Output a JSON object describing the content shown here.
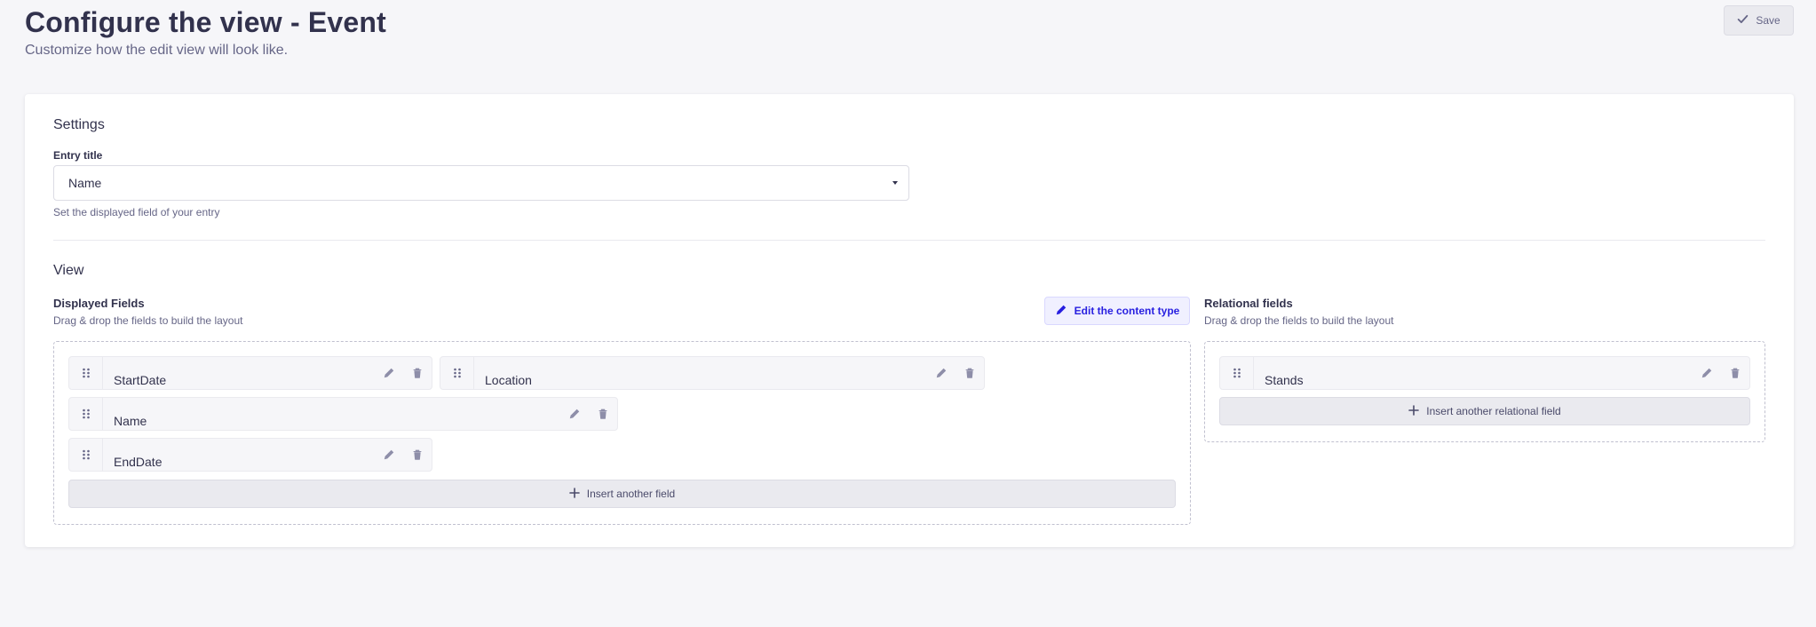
{
  "header": {
    "title": "Configure the view - Event",
    "subtitle": "Customize how the edit view will look like.",
    "save_label": "Save"
  },
  "settings": {
    "title": "Settings",
    "entry_title_label": "Entry title",
    "entry_title_value": "Name",
    "entry_title_hint": "Set the displayed field of your entry"
  },
  "view": {
    "title": "View",
    "displayed": {
      "title": "Displayed Fields",
      "hint": "Drag & drop the fields to build the layout",
      "edit_content_type_label": "Edit the content type",
      "fields": [
        "StartDate",
        "Location",
        "Name",
        "EndDate"
      ],
      "insert_label": "Insert another field"
    },
    "relational": {
      "title": "Relational fields",
      "hint": "Drag & drop the fields to build the layout",
      "fields": [
        "Stands"
      ],
      "insert_label": "Insert another relational field"
    }
  },
  "icons": {
    "save": "check-icon",
    "edit": "pencil-icon",
    "delete": "trash-icon",
    "drag": "drag-handle-icon",
    "add": "plus-icon",
    "select": "caret-down-icon"
  },
  "colors": {
    "background": "#f6f6f9",
    "primary": "#271fe0",
    "primary_light": "#f0f0ff",
    "text": "#32324d",
    "muted": "#666687"
  }
}
